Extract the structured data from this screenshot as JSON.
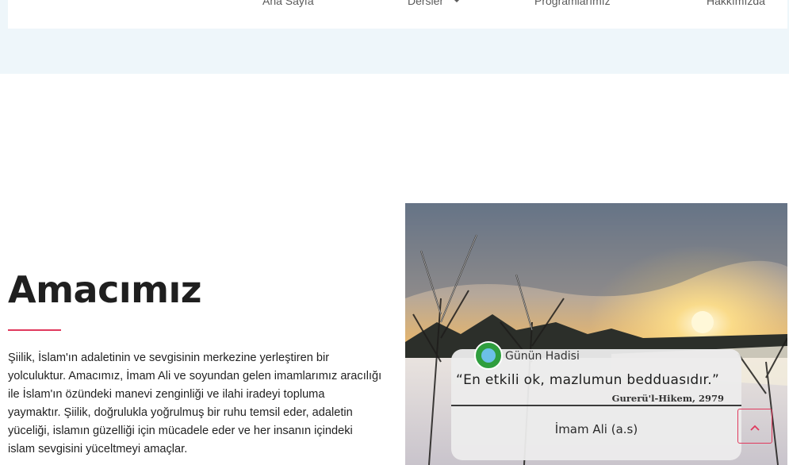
{
  "nav": {
    "items": [
      {
        "label": "Ana Sayfa"
      },
      {
        "label": "Dersler",
        "has_dropdown": true
      },
      {
        "label": "Programlarımız"
      },
      {
        "label": "Hakkımızda"
      }
    ]
  },
  "section": {
    "title": "Amacımız",
    "description_lines": [
      "Şiilik, İslam'ın adaletinin ve sevgisinin merkezine yerleştiren bir",
      "yolculuktur. Amacımız, İmam Ali ve soyundan gelen imamlarımız aracılığı",
      "ile İslam'ın özündeki manevi zenginliği ve ilahi iradeyi topluma",
      "yaymaktır. Şiilik, doğrulukla yoğrulmuş bir ruhu temsil eder, adaletin",
      "yüceliği, islamın güzelliği için mücadele eder ve her insanın içindeki",
      "islam sevgisini yüceltmeyi amaçlar."
    ]
  },
  "hadis_card": {
    "heading": "Günün Hadisi",
    "quote": "“En etkili ok, mazlumun bedduasıdır.”",
    "source": "Gurerü'l-Hikem, 2979",
    "author": "İmam Ali (a.s)"
  },
  "colors": {
    "accent": "#e0395d",
    "band": "#eef6fa"
  },
  "icons": {
    "dropdown": "chevron-down-icon",
    "scroll_top": "arrow-up-icon",
    "logo": "circle-logo-icon"
  }
}
